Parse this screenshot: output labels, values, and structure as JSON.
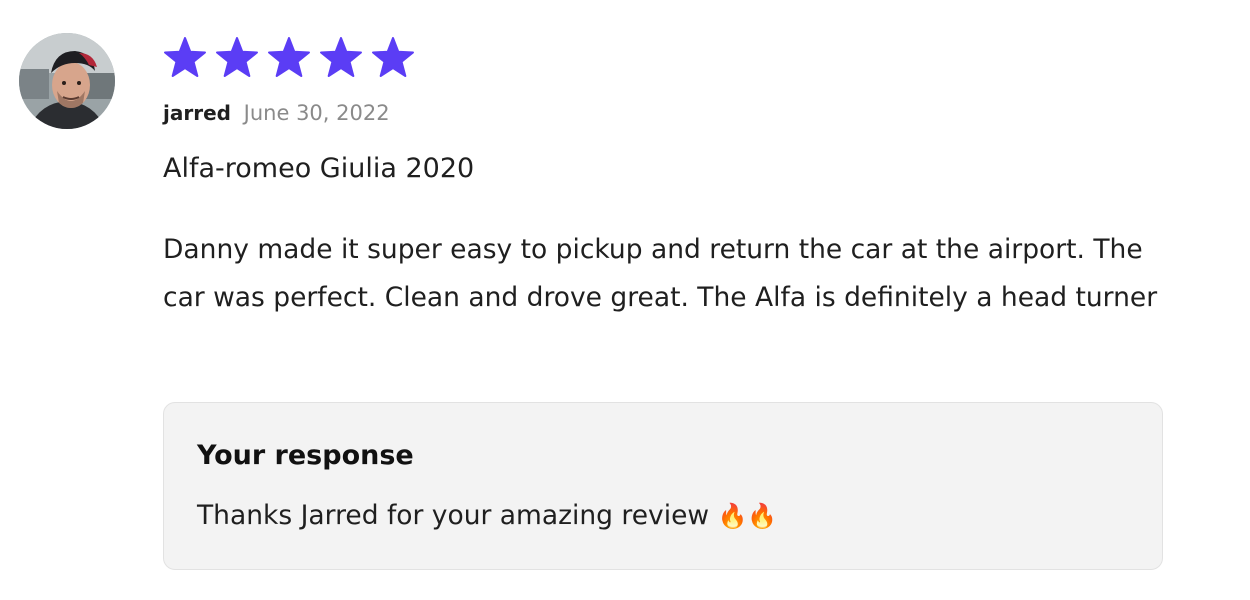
{
  "review": {
    "rating": 5,
    "rating_max": 5,
    "star_color": "#5b3df5",
    "reviewer_name": "jarred",
    "date": "June 30, 2022",
    "vehicle": "Alfa-romeo Giulia 2020",
    "body": "Danny made it super easy to pickup and return the car at the airport. The car was perfect. Clean and drove great. The Alfa is definitely a head turner"
  },
  "response": {
    "heading": "Your response",
    "text": "Thanks Jarred for your amazing review",
    "emoji": "🔥🔥"
  }
}
